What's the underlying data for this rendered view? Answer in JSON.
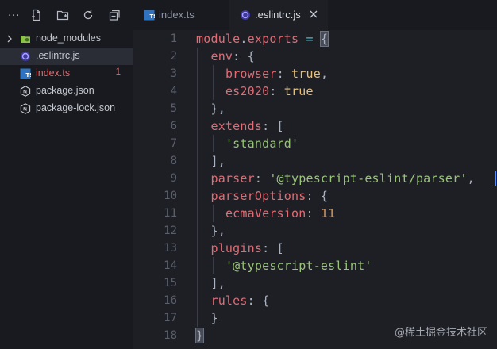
{
  "sidebar": {
    "overflow_label": "...",
    "toolbar": [
      {
        "icon": "new-file-icon"
      },
      {
        "icon": "new-folder-icon"
      },
      {
        "icon": "refresh-icon"
      },
      {
        "icon": "collapse-all-icon"
      }
    ],
    "tree": [
      {
        "label": "node_modules",
        "icon": "folder-icon",
        "kind": "folder",
        "expanded": false
      },
      {
        "label": ".eslintrc.js",
        "icon": "eslint-icon",
        "kind": "file",
        "selected": true
      },
      {
        "label": "index.ts",
        "icon": "typescript-icon",
        "kind": "file",
        "badge": "1",
        "error": true
      },
      {
        "label": "package.json",
        "icon": "nodejs-icon",
        "kind": "file"
      },
      {
        "label": "package-lock.json",
        "icon": "nodejs-icon",
        "kind": "file"
      }
    ]
  },
  "tabs": [
    {
      "label": "index.ts",
      "icon": "typescript-icon",
      "active": false
    },
    {
      "label": ".eslintrc.js",
      "icon": "eslint-icon",
      "active": true,
      "close_icon": "close-icon"
    }
  ],
  "editor": {
    "line_numbers": [
      "1",
      "2",
      "3",
      "4",
      "5",
      "6",
      "7",
      "8",
      "9",
      "10",
      "11",
      "12",
      "13",
      "14",
      "15",
      "16",
      "17",
      "18"
    ],
    "lines": [
      [
        [
          "ident",
          "module"
        ],
        [
          "punc",
          "."
        ],
        [
          "ident",
          "exports"
        ],
        [
          "op",
          " = "
        ],
        [
          "bracket",
          "{"
        ]
      ],
      [
        [
          "punc",
          "  "
        ],
        [
          "prop",
          "env"
        ],
        [
          "punc",
          ": {"
        ]
      ],
      [
        [
          "punc",
          "    "
        ],
        [
          "prop",
          "browser"
        ],
        [
          "punc",
          ": "
        ],
        [
          "kw",
          "true"
        ],
        [
          "punc",
          ","
        ]
      ],
      [
        [
          "punc",
          "    "
        ],
        [
          "prop",
          "es2020"
        ],
        [
          "punc",
          ": "
        ],
        [
          "kw",
          "true"
        ]
      ],
      [
        [
          "punc",
          "  },"
        ]
      ],
      [
        [
          "punc",
          "  "
        ],
        [
          "prop",
          "extends"
        ],
        [
          "punc",
          ": ["
        ]
      ],
      [
        [
          "punc",
          "    "
        ],
        [
          "str",
          "'standard'"
        ]
      ],
      [
        [
          "punc",
          "  ],"
        ]
      ],
      [
        [
          "punc",
          "  "
        ],
        [
          "prop",
          "parser"
        ],
        [
          "punc",
          ": "
        ],
        [
          "str",
          "'@typescript-eslint/parser'"
        ],
        [
          "punc",
          ","
        ]
      ],
      [
        [
          "punc",
          "  "
        ],
        [
          "prop",
          "parserOptions"
        ],
        [
          "punc",
          ": {"
        ]
      ],
      [
        [
          "punc",
          "    "
        ],
        [
          "prop",
          "ecmaVersion"
        ],
        [
          "punc",
          ": "
        ],
        [
          "num",
          "11"
        ]
      ],
      [
        [
          "punc",
          "  },"
        ]
      ],
      [
        [
          "punc",
          "  "
        ],
        [
          "prop",
          "plugins"
        ],
        [
          "punc",
          ": ["
        ]
      ],
      [
        [
          "punc",
          "    "
        ],
        [
          "str",
          "'@typescript-eslint'"
        ]
      ],
      [
        [
          "punc",
          "  ],"
        ]
      ],
      [
        [
          "punc",
          "  "
        ],
        [
          "prop",
          "rules"
        ],
        [
          "punc",
          ": {"
        ]
      ],
      [
        [
          "punc",
          "  }"
        ]
      ],
      [
        [
          "bracket",
          "}"
        ]
      ]
    ]
  },
  "colors": {
    "background": "#1e1f25",
    "sidebar": "#191a1f",
    "keyword": "#e5c07b",
    "property": "#e06c75",
    "string": "#98c379",
    "number": "#d19a66",
    "error": "#e06c6c"
  },
  "watermark": "@稀土掘金技术社区"
}
